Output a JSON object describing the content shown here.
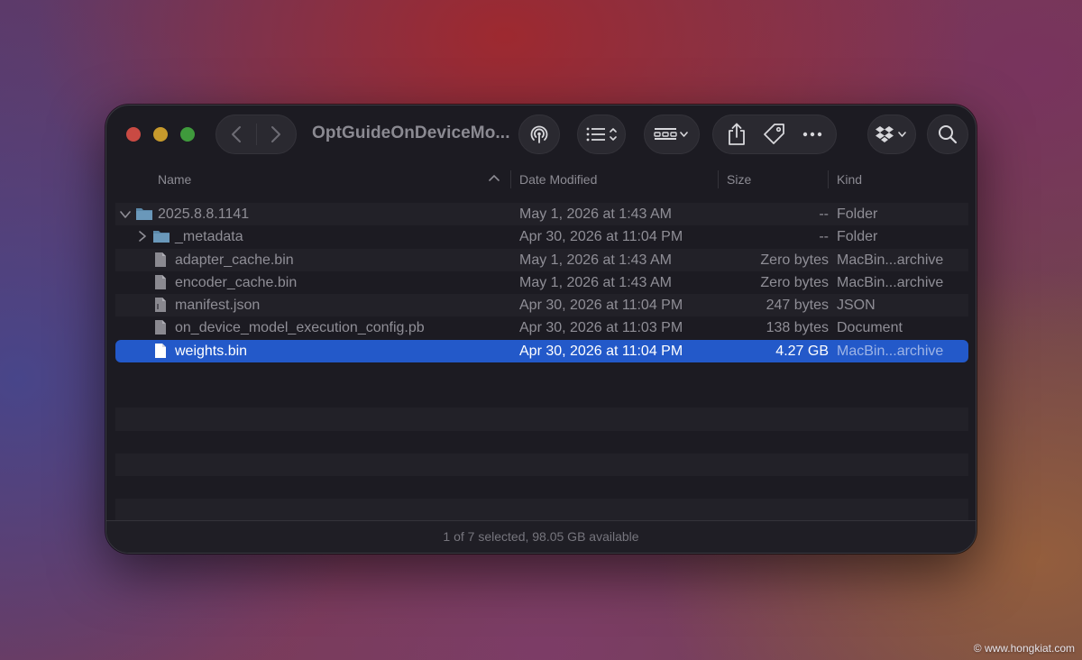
{
  "window": {
    "title": "OptGuideOnDeviceMo...",
    "status": "1 of 7 selected, 98.05 GB available"
  },
  "columns": {
    "name": "Name",
    "date": "Date Modified",
    "size": "Size",
    "kind": "Kind"
  },
  "toolbar_icons": [
    "chevron-left-icon",
    "chevron-right-icon",
    "airdrop-icon",
    "list-view-icon",
    "group-icon",
    "share-icon",
    "tag-icon",
    "more-icon",
    "dropbox-icon",
    "search-icon"
  ],
  "files": [
    {
      "name": "2025.8.8.1141",
      "date": "May 1, 2026 at 1:43 AM",
      "size": "--",
      "kind": "Folder",
      "type": "folder",
      "expanded": true
    },
    {
      "name": "_metadata",
      "date": "Apr 30, 2026 at 11:04 PM",
      "size": "--",
      "kind": "Folder",
      "type": "folder",
      "expanded": false
    },
    {
      "name": "adapter_cache.bin",
      "date": "May 1, 2026 at 1:43 AM",
      "size": "Zero bytes",
      "kind": "MacBin...archive",
      "type": "file"
    },
    {
      "name": "encoder_cache.bin",
      "date": "May 1, 2026 at 1:43 AM",
      "size": "Zero bytes",
      "kind": "MacBin...archive",
      "type": "file"
    },
    {
      "name": "manifest.json",
      "date": "Apr 30, 2026 at 11:04 PM",
      "size": "247 bytes",
      "kind": "JSON",
      "type": "file"
    },
    {
      "name": "on_device_model_execution_config.pb",
      "date": "Apr 30, 2026 at 11:03 PM",
      "size": "138 bytes",
      "kind": "Document",
      "type": "file"
    },
    {
      "name": "weights.bin",
      "date": "Apr 30, 2026 at 11:04 PM",
      "size": "4.27 GB",
      "kind": "MacBin...archive",
      "type": "file",
      "selected": true
    }
  ],
  "watermark": "© www.hongkiat.com",
  "colors": {
    "selection": "#2359c9",
    "close": "#c94a43",
    "minimize": "#c79a2c",
    "zoom": "#3f9a3c",
    "folder": "#5a87a8"
  }
}
